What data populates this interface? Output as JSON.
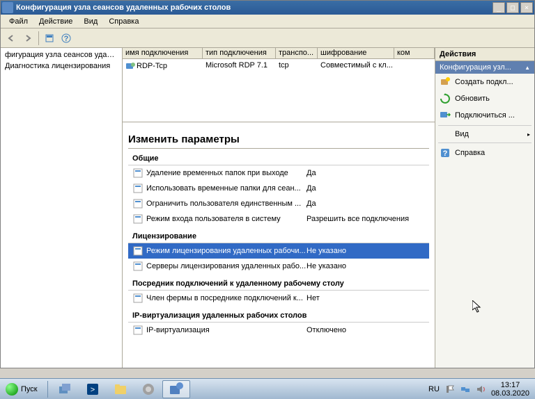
{
  "window": {
    "title": "Конфигурация узла сеансов удаленных рабочих столов",
    "controls": {
      "min": "_",
      "max": "□",
      "close": "×"
    }
  },
  "menu": {
    "file": "Файл",
    "action": "Действие",
    "view": "Вид",
    "help": "Справка"
  },
  "tree": {
    "item1": "фигурация узла сеансов удаленных",
    "item2": "Диагностика лицензирования"
  },
  "connList": {
    "headers": {
      "name": "имя подключения",
      "type": "тип подключения",
      "transport": "транспо...",
      "encryption": "шифрование",
      "comment": "ком"
    },
    "row": {
      "name": "RDP-Tcp",
      "type": "Microsoft RDP 7.1",
      "transport": "tcp",
      "encryption": "Совместимый с кл..."
    }
  },
  "settings": {
    "title": "Изменить параметры",
    "sections": {
      "general": {
        "header": "Общие",
        "items": [
          {
            "name": "Удаление временных папок при выходе",
            "value": "Да"
          },
          {
            "name": "Использовать временные папки для сеан...",
            "value": "Да"
          },
          {
            "name": "Ограничить пользователя единственным ...",
            "value": "Да"
          },
          {
            "name": "Режим входа пользователя в систему",
            "value": "Разрешить все подключения"
          }
        ]
      },
      "licensing": {
        "header": "Лицензирование",
        "items": [
          {
            "name": "Режим лицензирования удаленных рабочи...",
            "value": "Не указано"
          },
          {
            "name": "Серверы лицензирования удаленных рабо...",
            "value": "Не указано"
          }
        ]
      },
      "broker": {
        "header": "Посредник подключений к удаленному рабочему столу",
        "items": [
          {
            "name": "Член фермы в посреднике подключений к...",
            "value": "Нет"
          }
        ]
      },
      "ipvirt": {
        "header": "IP-виртуализация удаленных рабочих столов",
        "items": [
          {
            "name": "IP-виртуализация",
            "value": "Отключено"
          }
        ]
      }
    }
  },
  "actions": {
    "header": "Действия",
    "subheader": "Конфигурация узл...",
    "items": {
      "create": "Создать подкл...",
      "refresh": "Обновить",
      "connect": "Подключиться ...",
      "view": "Вид",
      "help": "Справка"
    }
  },
  "taskbar": {
    "start": "Пуск",
    "lang": "RU",
    "time": "13:17",
    "date": "08.03.2020"
  }
}
